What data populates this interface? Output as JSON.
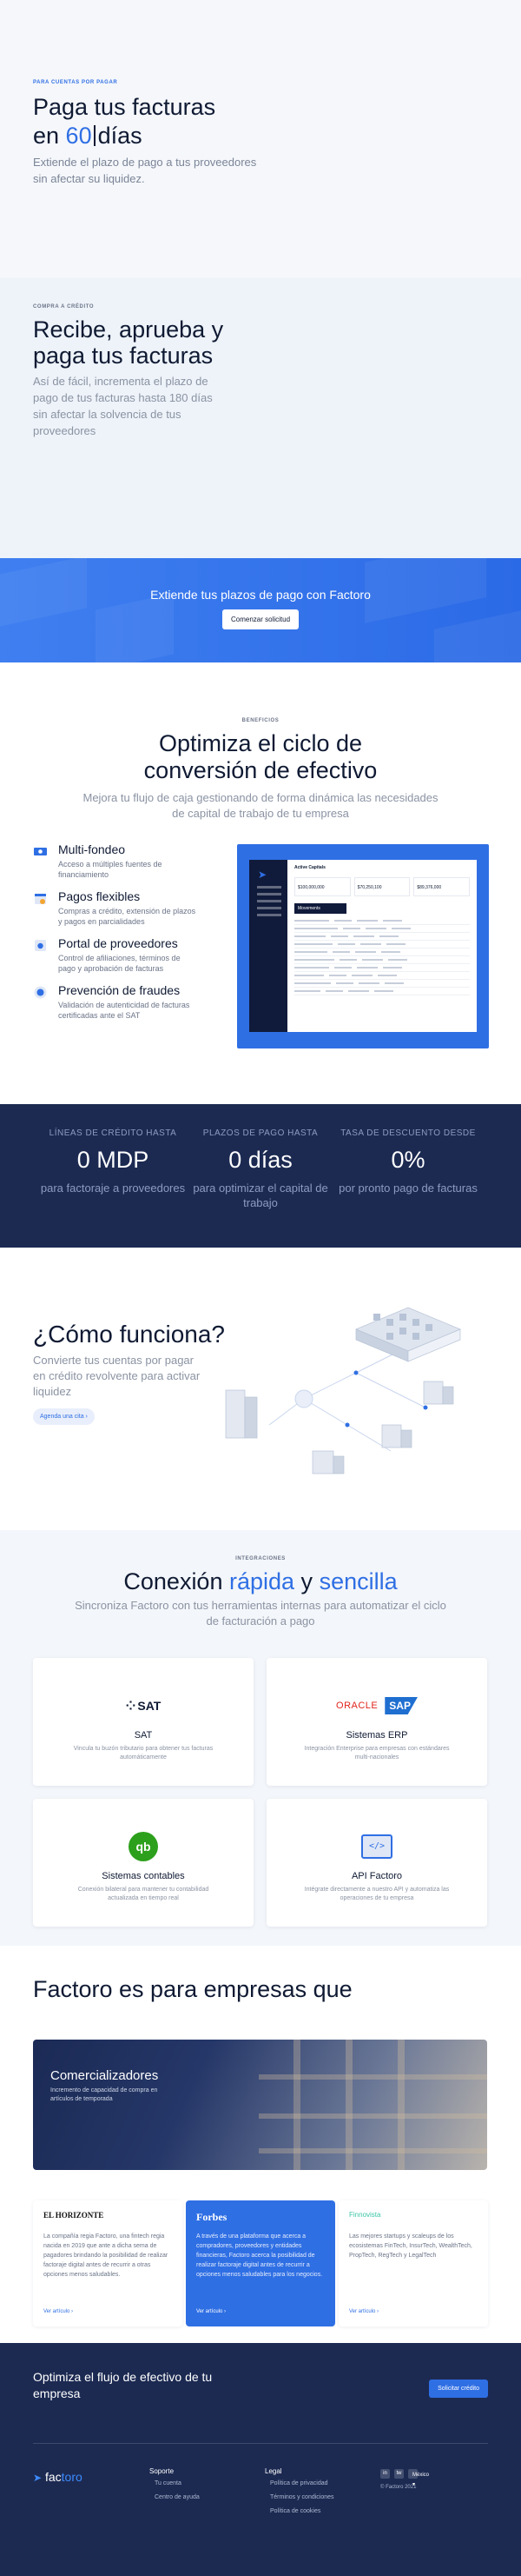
{
  "hero": {
    "eyebrow": "PARA CUENTAS POR PAGAR",
    "title_line1": "Paga tus facturas",
    "title_prefix": "en ",
    "title_number": "60",
    "title_suffix": "días",
    "subtitle": "Extiende el plazo de pago a tus proveedores sin afectar su liquidez."
  },
  "credit": {
    "eyebrow": "COMPRA A CRÉDITO",
    "title": "Recibe, aprueba y paga tus facturas",
    "subtitle": "Así de fácil, incrementa el plazo de pago de tus facturas hasta 180 días sin afectar la solvencia de tus proveedores"
  },
  "cta_band": {
    "title": "Extiende tus plazos de pago con Factoro",
    "button": "Comenzar solicitud"
  },
  "benefits": {
    "eyebrow": "BENEFICIOS",
    "title": "Optimiza el ciclo de conversión de efectivo",
    "subtitle": "Mejora tu flujo de caja gestionando de forma dinámica las necesidades de capital de trabajo de tu empresa",
    "items": [
      {
        "title": "Multi-fondeo",
        "desc": "Acceso a múltiples fuentes de financiamiento",
        "icon": "money-icon"
      },
      {
        "title": "Pagos flexibles",
        "desc": "Compras a crédito, extensión de plazos y pagos en parcialidades",
        "icon": "calendar-icon"
      },
      {
        "title": "Portal de proveedores",
        "desc": "Control de afiliaciones, términos de pago y aprobación de facturas",
        "icon": "portal-icon"
      },
      {
        "title": "Prevención de fraudes",
        "desc": "Validación de autenticidad de facturas certificadas ante el SAT",
        "icon": "shield-icon"
      }
    ],
    "dashboard": {
      "title": "Active Capitals",
      "stats": [
        "$100,000,000",
        "$70,250,100",
        "$89,376,000"
      ],
      "table_title": "Movements"
    }
  },
  "stats": [
    {
      "label": "LÍNEAS DE CRÉDITO HASTA",
      "value": "0 MDP",
      "desc": "para factoraje a proveedores"
    },
    {
      "label": "PLAZOS DE PAGO HASTA",
      "value": "0 días",
      "desc": "para optimizar el capital de trabajo"
    },
    {
      "label": "TASA DE DESCUENTO DESDE",
      "value": "0%",
      "desc": "por pronto pago de facturas"
    }
  ],
  "how": {
    "title": "¿Cómo funciona?",
    "subtitle": "Convierte tus cuentas por pagar en crédito revolvente para activar liquidez",
    "button": "Agenda una cita ›"
  },
  "integrations": {
    "eyebrow": "INTEGRACIONES",
    "title_prefix": "Conexión ",
    "title_word1": "rápida",
    "title_mid": " y ",
    "title_word2": "sencilla",
    "subtitle": "Sincroniza Factoro con tus herramientas internas para automatizar el ciclo de facturación a pago",
    "cards": [
      {
        "title": "SAT",
        "desc": "Vincula tu buzón tributario para obtener tus facturas automáticamente",
        "logo": "SAT"
      },
      {
        "title": "Sistemas ERP",
        "desc": "Integración Enterprise para empresas con estándares multi-nacionales",
        "logo_a": "ORACLE",
        "logo_b": "SAP"
      },
      {
        "title": "Sistemas contables",
        "desc": "Conexión bilateral para mantener tu contabilidad actualizada en tiempo real",
        "logo": "qb"
      },
      {
        "title": "API Factoro",
        "desc": "Intégrate directamente a nuestro API y automatiza las operaciones de tu empresa",
        "logo": "</>"
      }
    ]
  },
  "empresas": {
    "title": "Factoro es para empresas que",
    "card_title": "Comercializadores",
    "card_desc": "Incremento de capacidad de compra en artículos de temporada"
  },
  "quotes": [
    {
      "brand": "EL HORIZONTE",
      "text": "La compañía regia Factoro, una fintech regia nacida en 2019 que ante a dicha sema de pagadores brindando la posibilidad de realizar factoraje digital antes de recurrir a otras opciones menos saludables.",
      "link": "Ver artículo ›"
    },
    {
      "brand": "Forbes",
      "text": "A través de una plataforma que acerca a compradores, proveedores y entidades financieras, Factoro acerca la posibilidad de realizar factoraje digital antes de recurrir a opciones menos saludables para los negocios.",
      "link": "Ver artículo ›"
    },
    {
      "brand": "Finnovista",
      "text": "Las mejores startups y scaleups de los ecosistemas FinTech, InsurTech, WealthTech, PropTech, RegTech y LegalTech",
      "link": "Ver artículo ›"
    }
  ],
  "footer_cta": {
    "title": "Optimiza el flujo de efectivo de tu empresa",
    "button": "Solicitar crédito"
  },
  "footer": {
    "logo_a": "fac",
    "logo_b": "toro",
    "support_title": "Soporte",
    "support_links": [
      "Tu cuenta",
      "Centro de ayuda"
    ],
    "legal_title": "Legal",
    "legal_links": [
      "Política de privacidad",
      "Términos y condiciones",
      "Política de cookies"
    ],
    "social": [
      "in",
      "tw"
    ],
    "lang": "México ▾",
    "copyright": "© Factoro 2021"
  },
  "colors": {
    "accent": "#2f6fe4",
    "navy": "#1c2a52",
    "light": "#eef3f9"
  }
}
